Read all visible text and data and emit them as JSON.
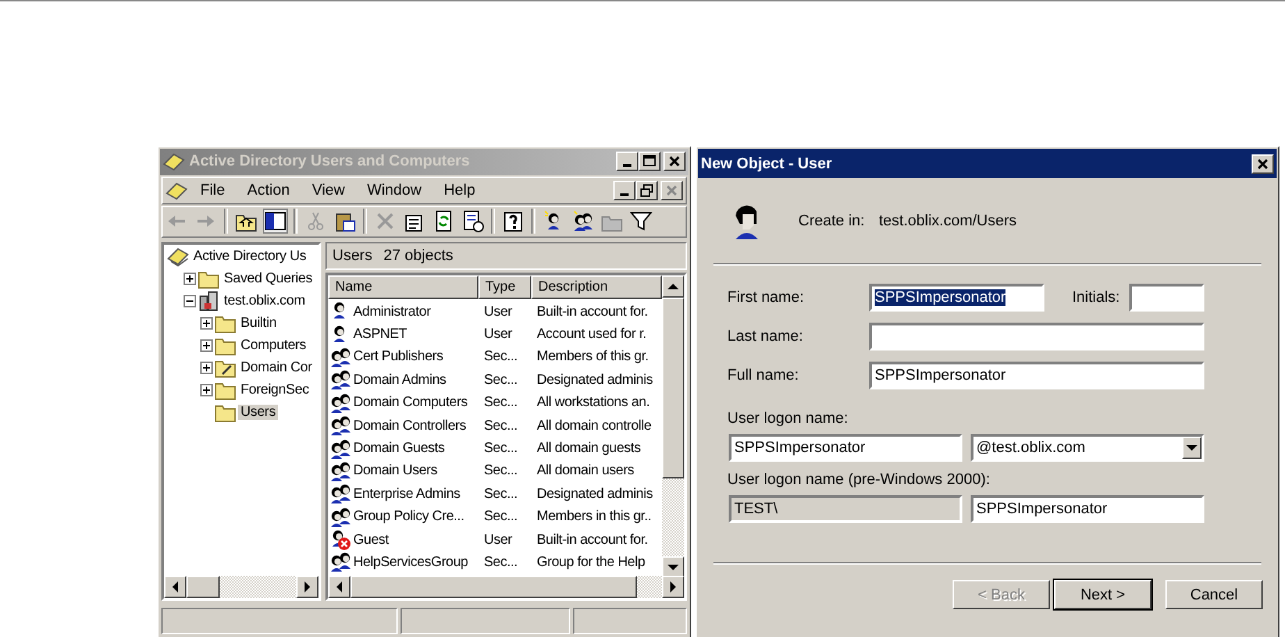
{
  "app_window": {
    "title": "Active Directory Users and Computers",
    "menu": [
      "File",
      "Action",
      "View",
      "Window",
      "Help"
    ],
    "tree": [
      {
        "label": "Active Directory Us",
        "kind": "root",
        "selected": false,
        "children": [
          {
            "label": "Saved Queries",
            "kind": "folder",
            "expanded": false,
            "selected": false
          },
          {
            "label": "test.oblix.com",
            "kind": "domain",
            "expanded": true,
            "selected": false,
            "children": [
              {
                "label": "Builtin",
                "kind": "folder",
                "expanded": false,
                "selected": false
              },
              {
                "label": "Computers",
                "kind": "folder",
                "expanded": false,
                "selected": false
              },
              {
                "label": "Domain Cor",
                "kind": "ou",
                "expanded": false,
                "selected": false
              },
              {
                "label": "ForeignSec",
                "kind": "folder",
                "expanded": false,
                "selected": false
              },
              {
                "label": "Users",
                "kind": "folder",
                "selected": true
              }
            ]
          }
        ]
      }
    ],
    "list": {
      "heading": "Users",
      "count": "27 objects",
      "columns": [
        "Name",
        "Type",
        "Description"
      ],
      "rows": [
        {
          "name": "Administrator",
          "type": "User",
          "description": "Built-in account for.",
          "kind": "user"
        },
        {
          "name": "ASPNET",
          "type": "User",
          "description": "Account used for r.",
          "kind": "user"
        },
        {
          "name": "Cert Publishers",
          "type": "Sec...",
          "description": "Members of this gr.",
          "kind": "group"
        },
        {
          "name": "Domain Admins",
          "type": "Sec...",
          "description": "Designated adminis",
          "kind": "group"
        },
        {
          "name": "Domain Computers",
          "type": "Sec...",
          "description": "All workstations an.",
          "kind": "group"
        },
        {
          "name": "Domain Controllers",
          "type": "Sec...",
          "description": "All domain controlle",
          "kind": "group"
        },
        {
          "name": "Domain Guests",
          "type": "Sec...",
          "description": "All domain guests",
          "kind": "group"
        },
        {
          "name": "Domain Users",
          "type": "Sec...",
          "description": "All domain users",
          "kind": "group"
        },
        {
          "name": "Enterprise Admins",
          "type": "Sec...",
          "description": "Designated adminis",
          "kind": "group"
        },
        {
          "name": "Group Policy Cre...",
          "type": "Sec...",
          "description": "Members in this gr..",
          "kind": "group"
        },
        {
          "name": "Guest",
          "type": "User",
          "description": "Built-in account for.",
          "kind": "disabled_user"
        },
        {
          "name": "HelpServicesGroup",
          "type": "Sec...",
          "description": "Group for the Help",
          "kind": "group"
        }
      ]
    }
  },
  "dialog": {
    "title": "New Object - User",
    "create_in_label": "Create in:",
    "create_in_value": "test.oblix.com/Users",
    "first_name": {
      "label": "First name:",
      "value": "SPPSImpersonator",
      "highlighted": true
    },
    "initials": {
      "label": "Initials:"
    },
    "last_name": {
      "label": "Last name:"
    },
    "full_name": {
      "label": "Full name:",
      "value": "SPPSImpersonator"
    },
    "logon_label": "User logon name:",
    "logon_name": {
      "value": "SPPSImpersonator"
    },
    "logon_domain": {
      "value": "@test.oblix.com"
    },
    "pre2000_label": "User logon name (pre-Windows 2000):",
    "pre2000_domain": {
      "value": "TEST\\",
      "disabled": true
    },
    "pre2000_name": {
      "value": "SPPSImpersonator",
      "disabled": false
    },
    "buttons": [
      {
        "label": "< Back",
        "disabled": true,
        "default": false
      },
      {
        "label": "Next >",
        "disabled": false,
        "default": true
      },
      {
        "label": "Cancel",
        "disabled": false,
        "default": false
      }
    ]
  }
}
